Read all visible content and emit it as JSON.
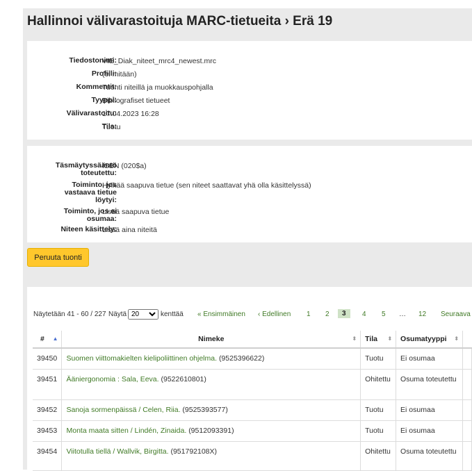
{
  "title": "Hallinnoi välivarastoituja MARC-tietueita › Erä 19",
  "batch_info": [
    {
      "label": "Tiedostonimi:",
      "value": "VIE_Diak_niteet_mrc4_newest.mrc"
    },
    {
      "label": "Profiili:",
      "value": "(ei mitään)"
    },
    {
      "label": "Kommentit:",
      "value": "Tuonti niteillä ja muokkauspohjalla"
    },
    {
      "label": "Tyyppi:",
      "value": "Bibliografiset tietueet"
    },
    {
      "label": "Välivarastoitu:",
      "value": "17.04.2023 16:28"
    },
    {
      "label": "Tila:",
      "value": "Tuotu"
    }
  ],
  "match_info": {
    "rule_label": "Täsmäytyssääntö toteutettu:",
    "rule_value": "ISBN (020$a)",
    "on_match_label": "Toiminto, jos vastaava tietue löytyi:",
    "on_match_value": "Hylkää saapuva tietue (sen niteet saattavat yhä olla käsittelyssä)",
    "no_match_label": "Toiminto, jos ei osumaa:",
    "no_match_value": "Lisää saapuva tietue",
    "items_label": "Niteen käsittely:",
    "items_value": "Lisää aina niteitä"
  },
  "cancel_button": "Peruuta tuonti",
  "pager": {
    "showing": "Näytetään 41 - 60 / 227",
    "show_label": "Näytä",
    "page_size": "20",
    "per_page_suffix": "kenttää",
    "first": "« Ensimmäinen",
    "prev": "‹ Edellinen",
    "pages": [
      "1",
      "2",
      "3",
      "4",
      "5"
    ],
    "current": "3",
    "ellipsis": "…",
    "last_page": "12",
    "next": "Seuraava"
  },
  "table": {
    "headers": [
      "#",
      "Nimeke",
      "Tila",
      "Osumatyyppi"
    ],
    "rows": [
      {
        "id": "39450",
        "title": "Suomen viittomakielten kielipoliittinen ohjelma.",
        "isbn": "(9525396622)",
        "status": "Tuotu",
        "match": "Ei osumaa"
      },
      {
        "id": "39451",
        "title": "Ääniergonomia : Sala, Eeva.",
        "isbn": "(9522610801)",
        "status": "Ohitettu",
        "match": "Osuma toteutettu"
      },
      {
        "id": "39452",
        "title": "Sanoja sormenpäissä / Celen, Riia.",
        "isbn": "(9525393577)",
        "status": "Tuotu",
        "match": "Ei osumaa"
      },
      {
        "id": "39453",
        "title": "Monta maata sitten / Lindén, Zinaida.",
        "isbn": "(9512093391)",
        "status": "Tuotu",
        "match": "Ei osumaa"
      },
      {
        "id": "39454",
        "title": "Viitotulla tiellä / Wallvik, Birgitta.",
        "isbn": "(951792108X)",
        "status": "Ohitettu",
        "match": "Osuma toteutettu"
      }
    ]
  },
  "colors": {
    "accent": "#407a26",
    "button": "#ffc72c",
    "current_page": "#cfe2c6"
  }
}
